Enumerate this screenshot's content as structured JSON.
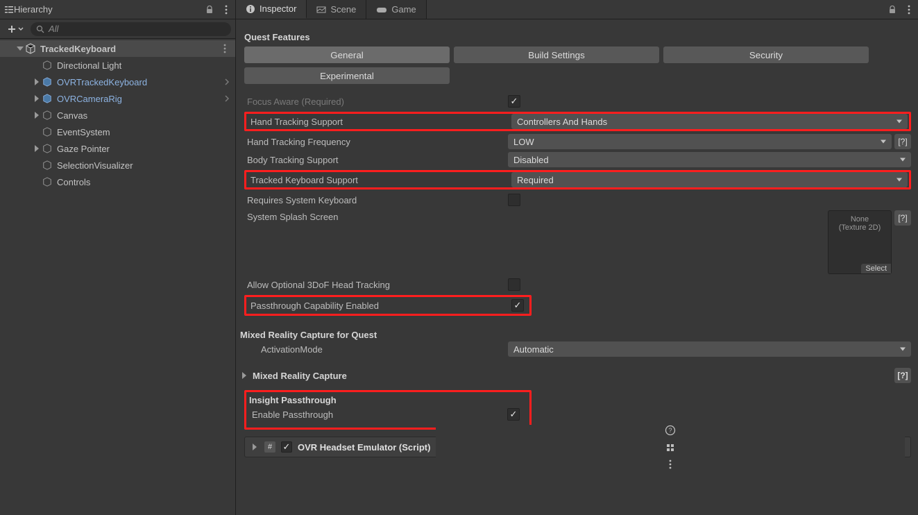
{
  "hierarchy": {
    "panel_title": "Hierarchy",
    "search_placeholder": "All",
    "items": {
      "root": "TrackedKeyboard",
      "c0": "Directional Light",
      "c1": "OVRTrackedKeyboard",
      "c2": "OVRCameraRig",
      "c3": "Canvas",
      "c4": "EventSystem",
      "c5": "Gaze Pointer",
      "c6": "SelectionVisualizer",
      "c7": "Controls"
    }
  },
  "tabs": {
    "inspector": "Inspector",
    "scene": "Scene",
    "game": "Game"
  },
  "quest": {
    "title": "Quest Features",
    "btn_general": "General",
    "btn_build": "Build Settings",
    "btn_security": "Security",
    "btn_experimental": "Experimental",
    "focus_aware": "Focus Aware (Required)",
    "hand_tracking_support": "Hand Tracking Support",
    "hand_tracking_support_val": "Controllers And Hands",
    "hand_tracking_freq": "Hand Tracking Frequency",
    "hand_tracking_freq_val": "LOW",
    "body_tracking": "Body Tracking Support",
    "body_tracking_val": "Disabled",
    "tracked_kb": "Tracked Keyboard Support",
    "tracked_kb_val": "Required",
    "req_sys_kb": "Requires System Keyboard",
    "splash": "System Splash Screen",
    "splash_none": "None",
    "splash_type": "(Texture 2D)",
    "splash_select": "Select",
    "allow_3dof": "Allow Optional 3DoF Head Tracking",
    "passthrough_cap": "Passthrough Capability Enabled",
    "help": "[?]"
  },
  "mrc_quest": {
    "title": "Mixed Reality Capture for Quest",
    "activation_mode": "ActivationMode",
    "activation_mode_val": "Automatic"
  },
  "mrc": {
    "title": "Mixed Reality Capture"
  },
  "insight": {
    "title": "Insight Passthrough",
    "enable": "Enable Passthrough"
  },
  "headset_emu": {
    "title": "OVR Headset Emulator (Script)"
  }
}
